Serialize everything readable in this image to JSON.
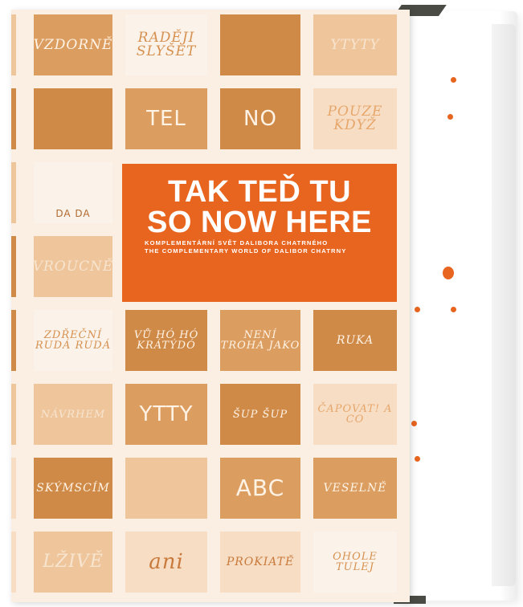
{
  "cover": {
    "title_cz": "TAK TEĎ TU",
    "title_en": "SO NOW HERE",
    "subtitle_cz": "KOMPLEMENTÁRNÍ SVĚT DALIBORA CHATRNÉHO",
    "subtitle_en": "THE COMPLEMENTARY WORLD OF DALIBOR CHATRNY",
    "accent_color": "#e8651f",
    "tile_color": "#d08a48"
  },
  "tiles": [
    "VZDORNĚ",
    "RADĚJI SLYŠET",
    "",
    "YTYTY",
    "",
    "TEL",
    "NO",
    "POUZE KDYŽ",
    "DA DA",
    "",
    "VROUCNĚ",
    "ZDŘEČNÍ RUDÁ RUDÁ",
    "VŮ HÓ HÓ KRÁTÝDÓ",
    "NENÍ TROHA JAKO",
    "RUKA",
    "NÁVRHEM",
    "YTTY",
    "ŠUP ŠUP",
    "ČAPOVAT! A CO",
    "SKÝMSCÍM",
    "",
    "ABC",
    "VESELNĚ",
    "LŽIVĚ",
    "ani",
    "PROKIATĚ",
    "OHOLE TULEJ"
  ]
}
